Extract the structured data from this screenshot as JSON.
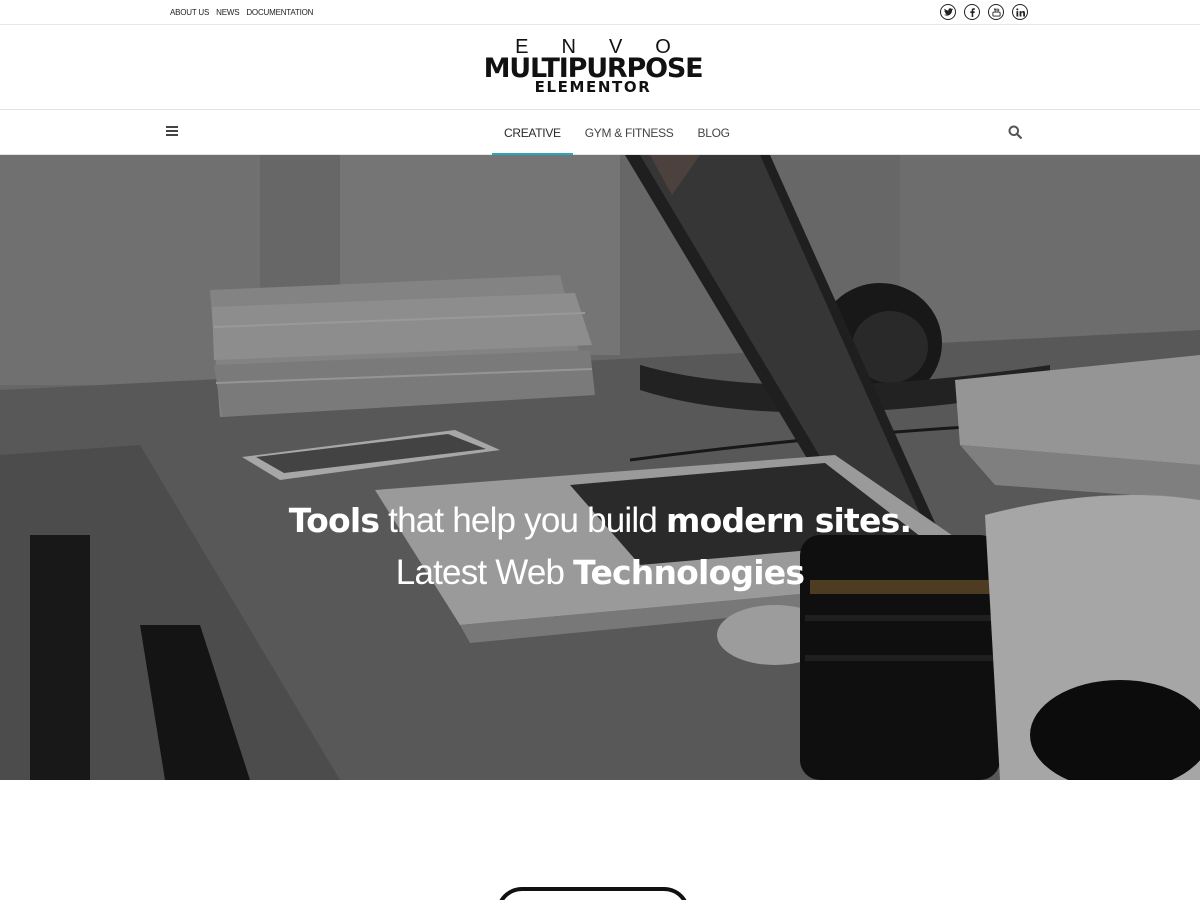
{
  "topbar": {
    "links": [
      "ABOUT US",
      "NEWS",
      "DOCUMENTATION"
    ],
    "social_icons": [
      "twitter-icon",
      "facebook-icon",
      "youtube-icon",
      "linkedin-icon"
    ]
  },
  "logo": {
    "line1": "ENVO",
    "line2": "MULTIPURPOSE",
    "line3": "ELEMENTOR"
  },
  "nav": {
    "items": [
      {
        "label": "CREATIVE",
        "active": true
      },
      {
        "label": "GYM & FITNESS",
        "active": false
      },
      {
        "label": "BLOG",
        "active": false
      }
    ],
    "menu_icon": "hamburger-icon",
    "search_icon": "search-icon",
    "accent_color": "#2aa7c0"
  },
  "hero": {
    "line1": {
      "bold_start": "Tools",
      "light": " that help you build ",
      "bold_end": "modern sites."
    },
    "line2": {
      "light": "Latest Web ",
      "bold": "Technologies"
    }
  }
}
